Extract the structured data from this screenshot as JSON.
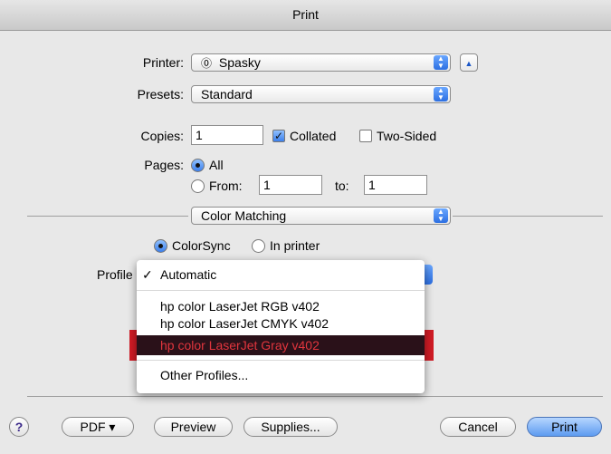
{
  "window": {
    "title": "Print"
  },
  "printer": {
    "label": "Printer:",
    "value": "Spasky",
    "status_glyph": "⓪"
  },
  "presets": {
    "label": "Presets:",
    "value": "Standard"
  },
  "copies": {
    "label": "Copies:",
    "value": "1",
    "collated_label": "Collated",
    "collated_checked": true,
    "two_sided_label": "Two-Sided",
    "two_sided_checked": false
  },
  "pages": {
    "label": "Pages:",
    "all_label": "All",
    "from_label": "From:",
    "from_value": "1",
    "to_label": "to:",
    "to_value": "1",
    "selected": "All"
  },
  "section": {
    "value": "Color Matching"
  },
  "color": {
    "colorsync_label": "ColorSync",
    "in_printer_label": "In printer",
    "selected": "ColorSync"
  },
  "profile": {
    "label": "Profile",
    "check_glyph": "✓",
    "menu": [
      {
        "label": "Automatic",
        "checked": true
      },
      {
        "label": "hp color LaserJet RGB v402"
      },
      {
        "label": "hp color LaserJet CMYK v402"
      },
      {
        "label": "hp color LaserJet Gray v402",
        "highlighted": true
      },
      {
        "label": "Other Profiles..."
      }
    ]
  },
  "buttons": {
    "help": "?",
    "pdf": "PDF ▾",
    "preview": "Preview",
    "supplies": "Supplies...",
    "cancel": "Cancel",
    "print": "Print"
  },
  "colors": {
    "accent_blue": "#3c80ec",
    "highlight_red": "#d11b25",
    "selection_dark": "#2a1119"
  }
}
